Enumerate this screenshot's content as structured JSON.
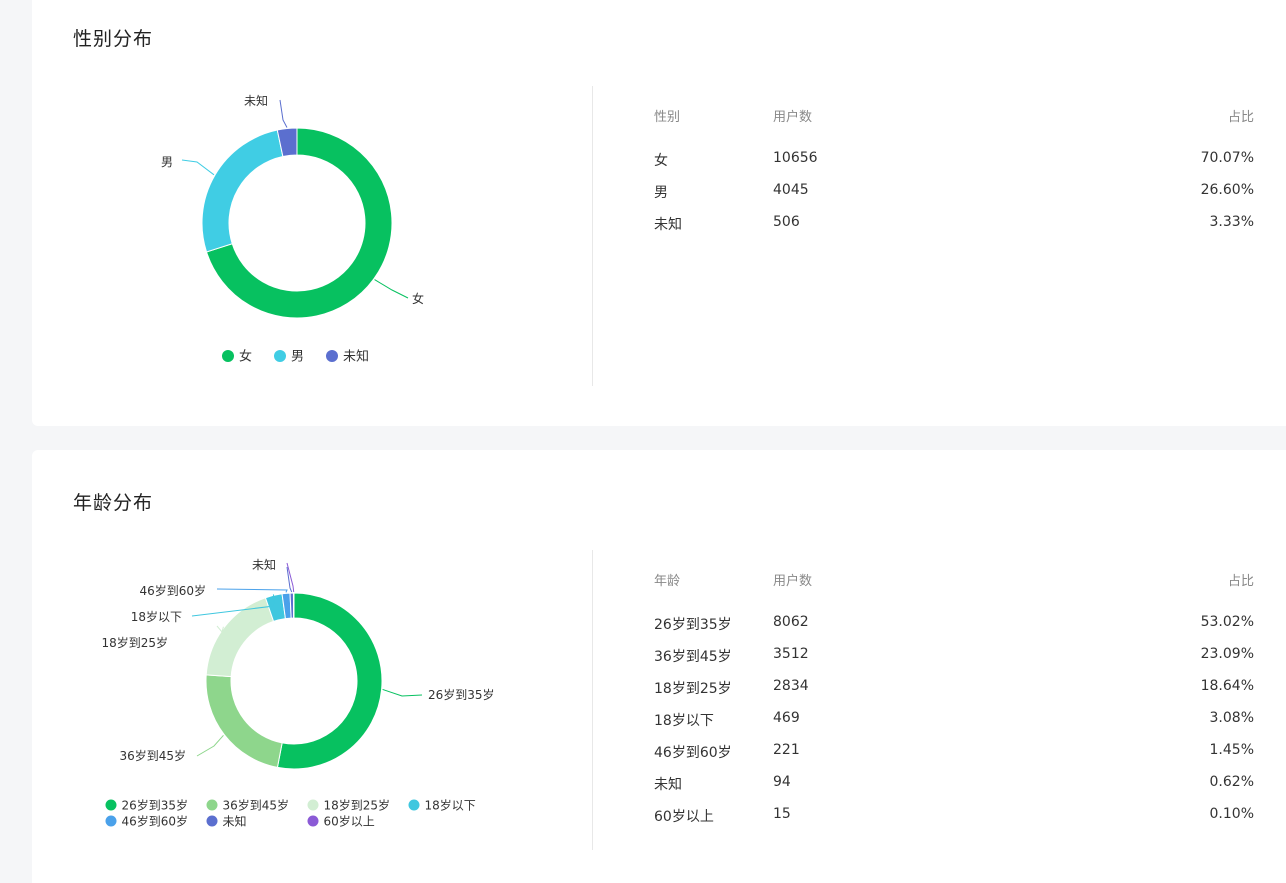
{
  "gender": {
    "title": "性别分布",
    "table_headers": [
      "性别",
      "用户数",
      "占比"
    ],
    "rows": [
      {
        "label": "女",
        "count": "10656",
        "pct": "70.07%"
      },
      {
        "label": "男",
        "count": "4045",
        "pct": "26.60%"
      },
      {
        "label": "未知",
        "count": "506",
        "pct": "3.33%"
      }
    ]
  },
  "age": {
    "title": "年龄分布",
    "table_headers": [
      "年龄",
      "用户数",
      "占比"
    ],
    "rows": [
      {
        "label": "26岁到35岁",
        "count": "8062",
        "pct": "53.02%"
      },
      {
        "label": "36岁到45岁",
        "count": "3512",
        "pct": "23.09%"
      },
      {
        "label": "18岁到25岁",
        "count": "2834",
        "pct": "18.64%"
      },
      {
        "label": "18岁以下",
        "count": "469",
        "pct": "3.08%"
      },
      {
        "label": "46岁到60岁",
        "count": "221",
        "pct": "1.45%"
      },
      {
        "label": "未知",
        "count": "94",
        "pct": "0.62%"
      },
      {
        "label": "60岁以上",
        "count": "15",
        "pct": "0.10%"
      }
    ]
  },
  "chart_data": [
    {
      "type": "pie",
      "title": "性别分布",
      "categories": [
        "女",
        "男",
        "未知"
      ],
      "values": [
        10656,
        4045,
        506
      ],
      "colors": [
        "#07c160",
        "#40cde4",
        "#5b6fcf"
      ],
      "legend": "bottom"
    },
    {
      "type": "pie",
      "title": "年龄分布",
      "categories": [
        "26岁到35岁",
        "36岁到45岁",
        "18岁到25岁",
        "18岁以下",
        "46岁到60岁",
        "未知",
        "60岁以上"
      ],
      "values": [
        8062,
        3512,
        2834,
        469,
        221,
        94,
        15
      ],
      "colors": [
        "#07c160",
        "#8ed68c",
        "#d2eed3",
        "#3fc7df",
        "#4aa1ea",
        "#5b6fcf",
        "#8b5ad6"
      ],
      "legend": "bottom"
    }
  ]
}
